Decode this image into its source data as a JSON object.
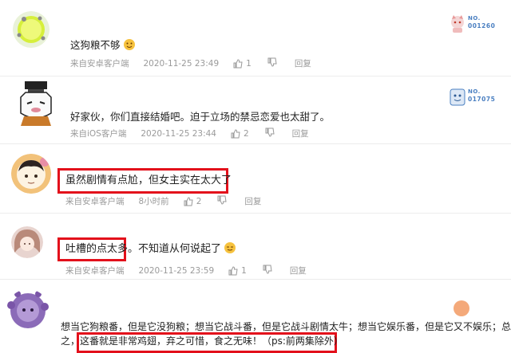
{
  "comments": [
    {
      "text": "这狗粮不够",
      "source": "来自安卓客户端",
      "time": "2020-11-25 23:49",
      "likes": "1",
      "reply": "回复",
      "badge": {
        "no": "NO.",
        "num": "001260"
      }
    },
    {
      "text": "好家伙，你们直接结婚吧。迫于立场的禁忌恋爱也太甜了。",
      "source": "来自iOS客户端",
      "time": "2020-11-25 23:44",
      "likes": "2",
      "reply": "回复",
      "badge": {
        "no": "NO.",
        "num": "017075"
      }
    },
    {
      "text": "虽然剧情有点尬，但女主实在太大了",
      "source": "来自安卓客户端",
      "time": "8小时前",
      "likes": "2",
      "reply": "回复"
    },
    {
      "text_highlight": "吐槽的点太多",
      "text_rest": "。不知道从何说起了",
      "source": "来自安卓客户端",
      "time": "2020-11-25 23:59",
      "likes": "1",
      "reply": "回复"
    },
    {
      "line1": "想当它狗粮番，但是它没狗粮；想当它战斗番，但是它战斗剧情太牛；想当它娱乐番，但是它又不娱乐；总",
      "line2_prefix": "之，",
      "line2_highlight": "这番就是非常鸡翅，弃之可惜，食之无味！（ps:前两集除外）"
    }
  ],
  "colors": {
    "highlight_box": "#e3101b",
    "meta_text": "#9a9a9a",
    "badge_text": "#4a7fc1"
  }
}
